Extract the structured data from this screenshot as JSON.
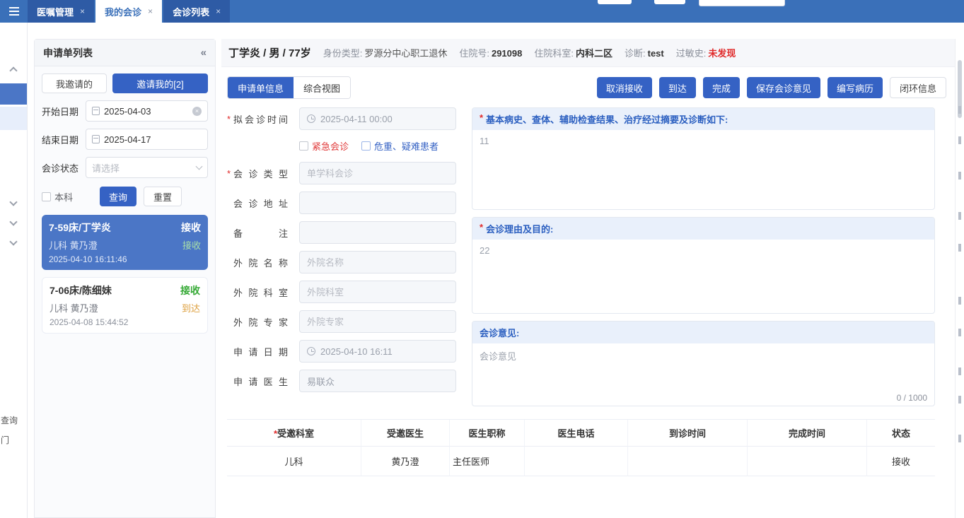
{
  "colors": {
    "header_blue": "#3a70b9",
    "accent_blue": "#3562c4",
    "selected_card": "#4b76c6",
    "success_green": "#35a935",
    "warning_orange": "#dd9f3d",
    "danger_red": "#e02a2a",
    "section_header_bg": "#e9f0fb",
    "section_header_text": "#2b5fc0"
  },
  "topbar": {
    "close": "×",
    "tabs": [
      {
        "label": "医嘱管理"
      },
      {
        "label": "我的会诊"
      },
      {
        "label": "会诊列表"
      }
    ]
  },
  "rail": {
    "fragment1": "查询",
    "fragment2": "门"
  },
  "left_panel": {
    "title": "申请单列表",
    "collapse": "«",
    "tab_invited_by_me": "我邀请的",
    "tab_invite_me": "邀请我的[2]",
    "start_label": "开始日期",
    "start_value": "2025-04-03",
    "end_label": "结束日期",
    "end_value": "2025-04-17",
    "status_label": "会诊状态",
    "status_placeholder": "请选择",
    "local_dept_label": "本科",
    "search_label": "查询",
    "reset_label": "重置",
    "cards": [
      {
        "title": "7-59床/丁学炎",
        "badge": "接收",
        "dept_doctor": "儿科 黄乃澄",
        "sub_status": "接收",
        "time": "2025-04-10 16:11:46"
      },
      {
        "title": "7-06床/陈细妹",
        "badge": "接收",
        "dept_doctor": "儿科 黄乃澄",
        "sub_status": "到达",
        "time": "2025-04-08 15:44:52"
      }
    ]
  },
  "patient": {
    "name": "丁学炎 / 男 / 77岁",
    "id_type_label": "身份类型:",
    "id_type": "罗源分中心职工退休",
    "adm_no_label": "住院号:",
    "adm_no": "291098",
    "dept_label": "住院科室:",
    "dept": "内科二区",
    "diag_label": "诊断:",
    "diag": "test",
    "allergy_label": "过敏史:",
    "allergy": "未发现"
  },
  "toolbar": {
    "tab_apply_info": "申请单信息",
    "tab_overview": "综合视图",
    "btn_cancel_receive": "取消接收",
    "btn_arrive": "到达",
    "btn_finish": "完成",
    "btn_save_opinion": "保存会诊意见",
    "btn_write_record": "编写病历",
    "btn_loop_info": "闭环信息"
  },
  "form": {
    "mark": "*",
    "cb_urgent": "紧急会诊",
    "cb_critical": "危重、疑难患者",
    "rows": [
      {
        "label": "拟会诊时间",
        "value": "2025-04-11 00:00"
      },
      {
        "label": "会诊类型",
        "placeholder": "单学科会诊"
      },
      {
        "label": "会诊地址"
      },
      {
        "label": "备注"
      },
      {
        "label": "外院名称",
        "placeholder": "外院名称"
      },
      {
        "label": "外院科室",
        "placeholder": "外院科室"
      },
      {
        "label": "外院专家",
        "placeholder": "外院专家"
      },
      {
        "label": "申请日期",
        "value": "2025-04-10 16:11"
      },
      {
        "label": "申请医生",
        "value": "易联众"
      }
    ]
  },
  "sections": {
    "mark": "*",
    "history_title": "基本病史、查体、辅助检查结果、治疗经过摘要及诊断如下:",
    "history_value": "11",
    "reason_title": "会诊理由及目的:",
    "reason_value": "22",
    "opinion_title": "会诊意见:",
    "opinion_placeholder": "会诊意见",
    "opinion_counter": "0 / 1000"
  },
  "table": {
    "mark": "*",
    "headers": [
      {
        "label": "受邀科室"
      },
      {
        "label": "受邀医生"
      },
      {
        "label": "医生职称"
      },
      {
        "label": "医生电话"
      },
      {
        "label": "到诊时间"
      },
      {
        "label": "完成时间"
      },
      {
        "label": "状态"
      }
    ],
    "row": {
      "dept": "儿科",
      "doctor": "黄乃澄",
      "title": "主任医师",
      "phone": "",
      "arrive_time": "",
      "finish_time": "",
      "status": "接收"
    }
  }
}
